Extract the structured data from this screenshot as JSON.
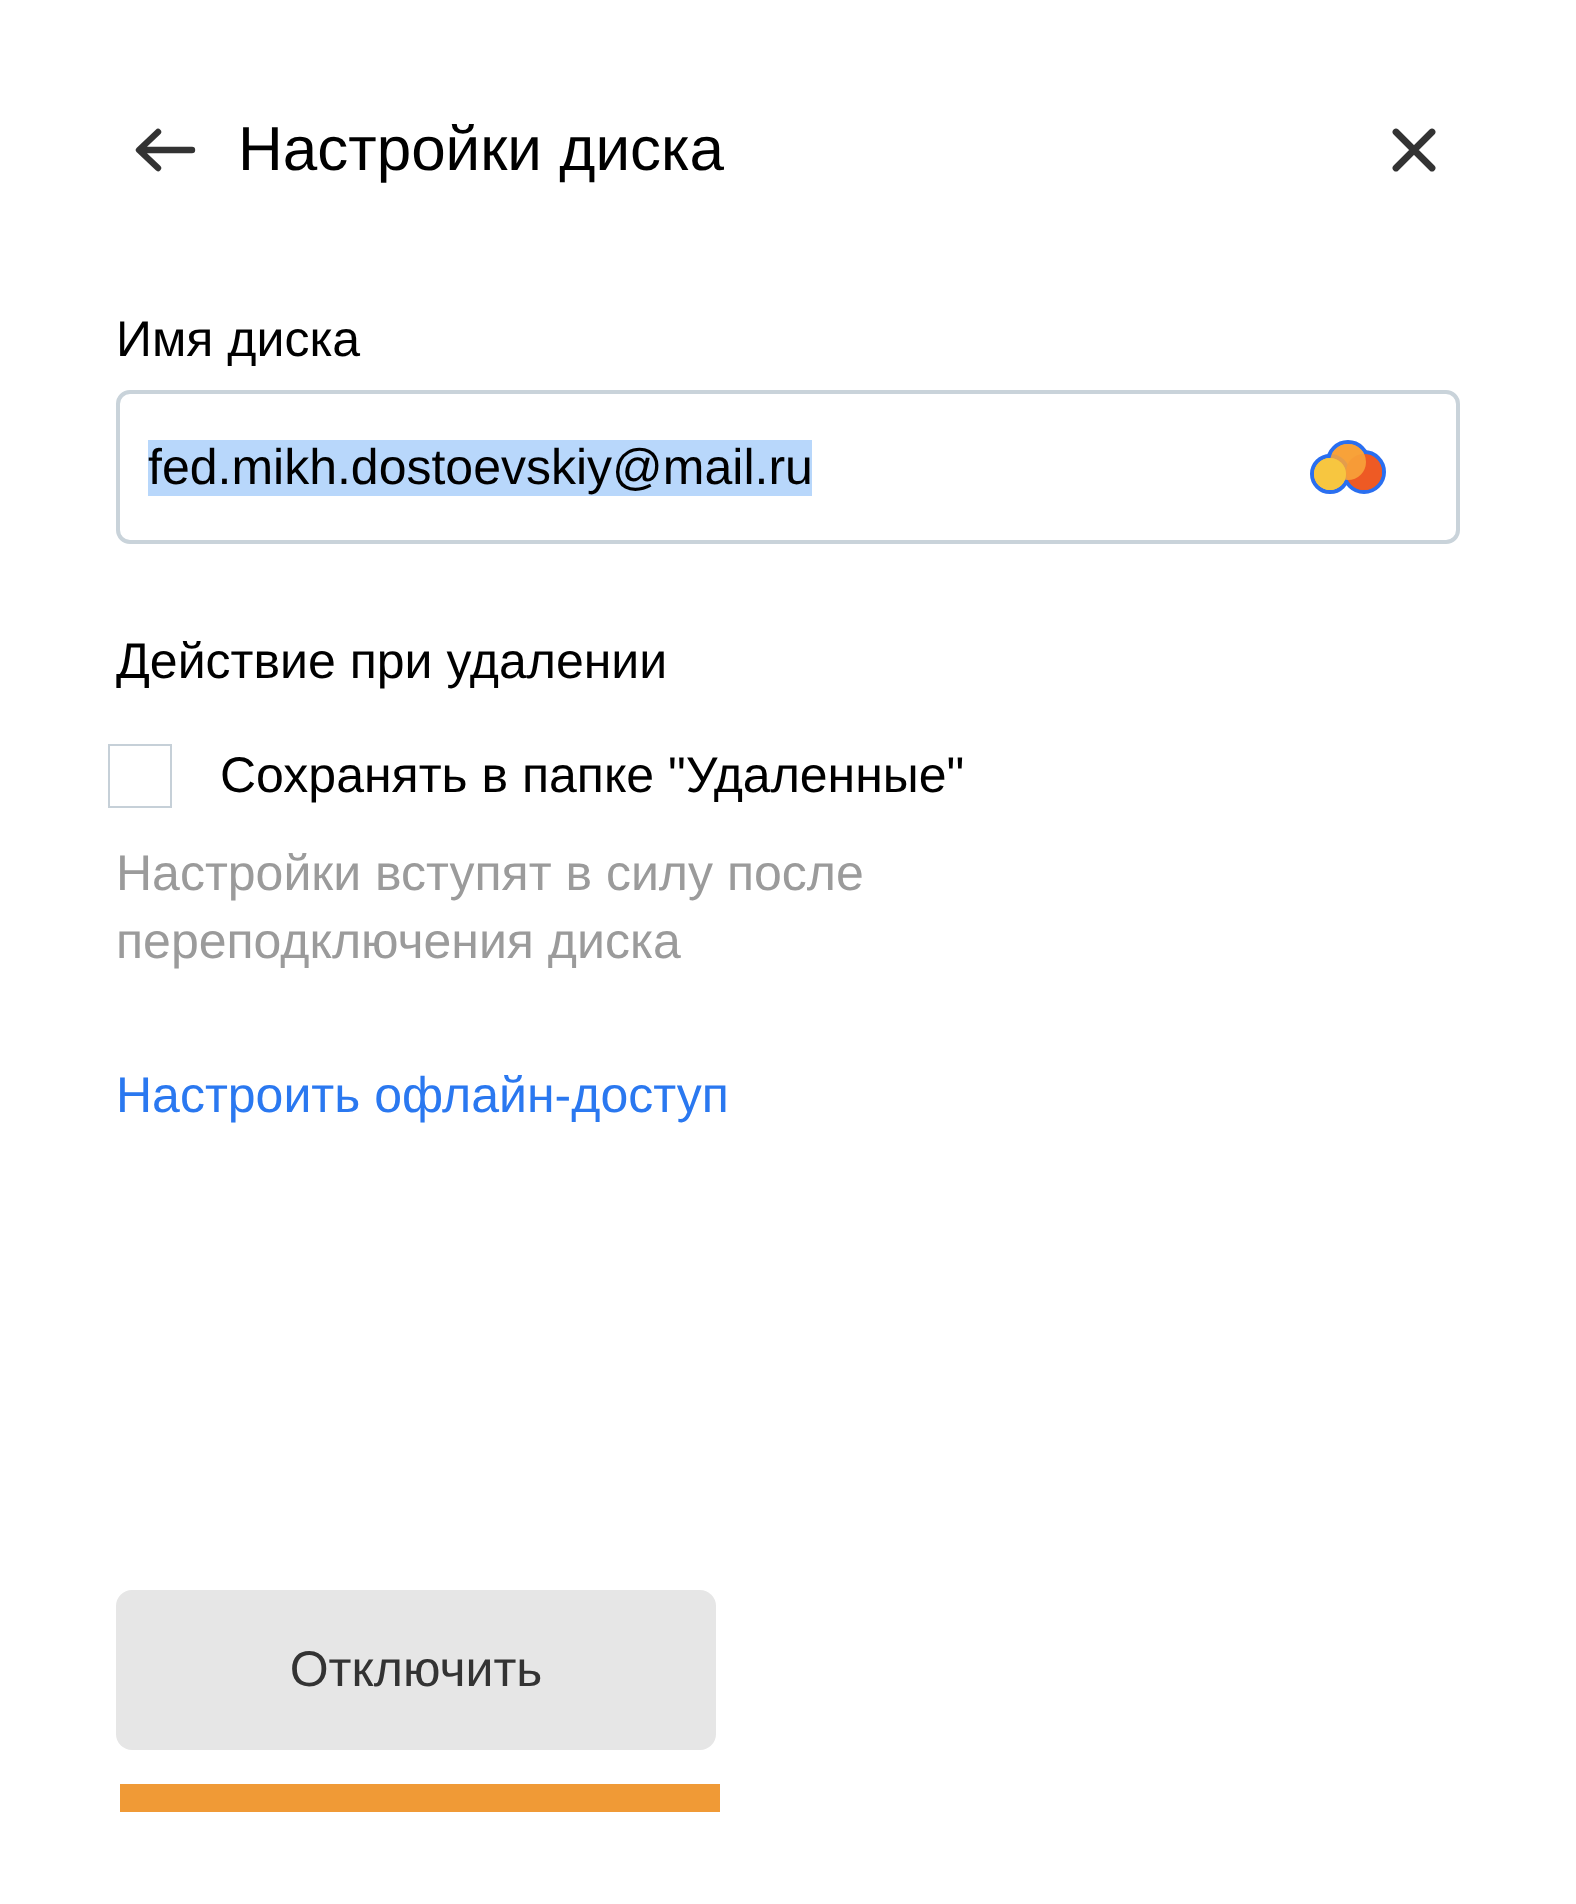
{
  "header": {
    "title": "Настройки диска"
  },
  "disk_name": {
    "label": "Имя диска",
    "value": "fed.mikh.dostoevskiy@mail.ru",
    "text_selected": true
  },
  "delete_action": {
    "title": "Действие при удалении",
    "checkbox": {
      "label": "Сохранять в папке \"Удаленные\"",
      "checked": false
    },
    "hint": "Настройки вступят в силу после переподключения диска"
  },
  "offline_link": "Настроить офлайн-доступ",
  "buttons": [
    {
      "label": "Отключить"
    }
  ]
}
